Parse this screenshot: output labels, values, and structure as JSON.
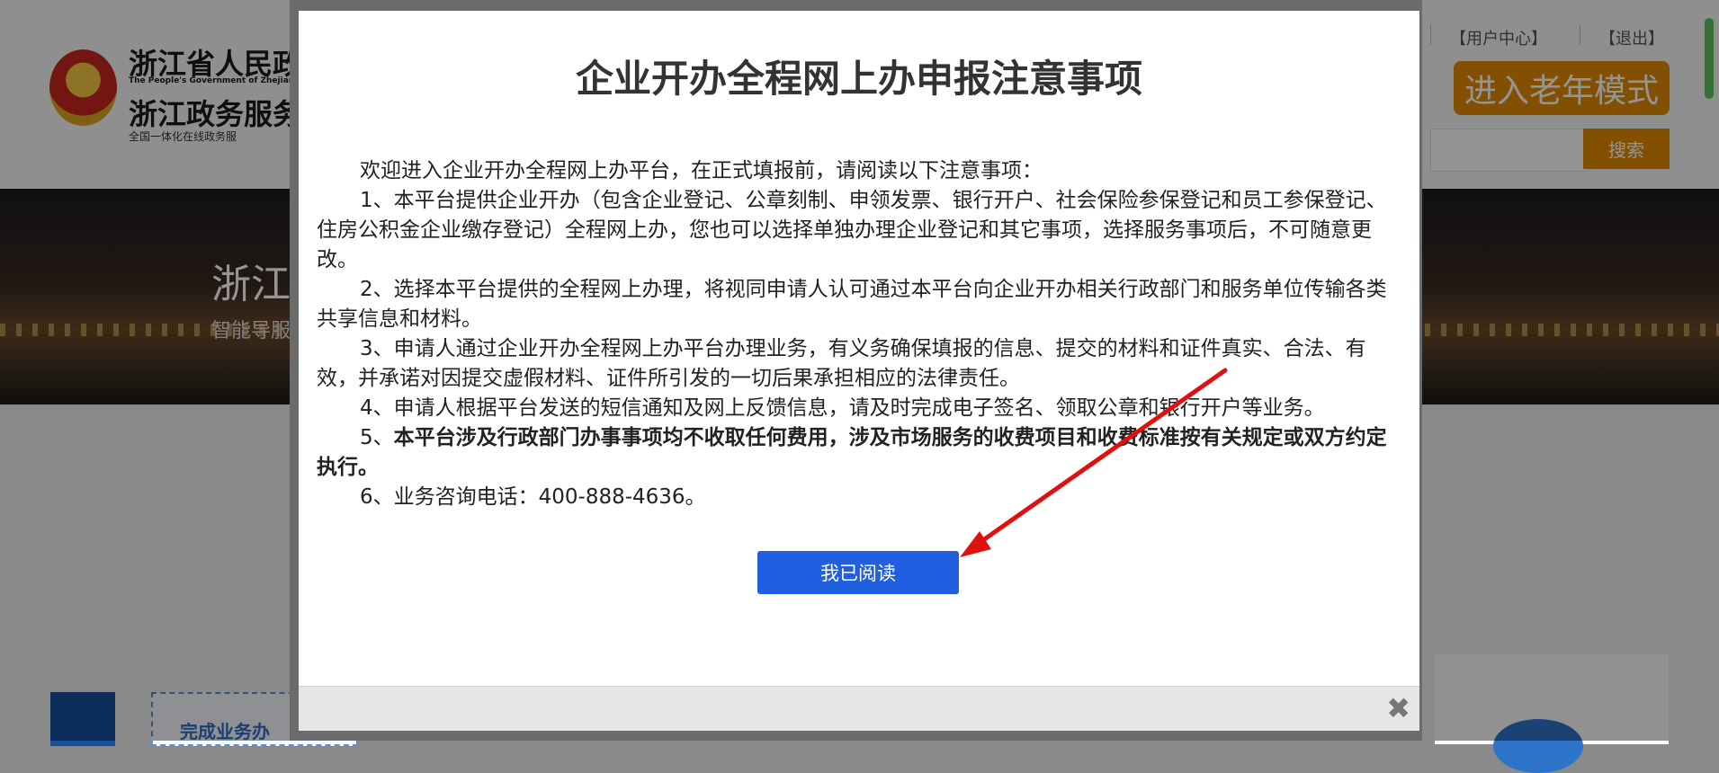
{
  "header": {
    "logo_cn_line1": "浙江省人民政",
    "logo_en": "The People's Government of Zhejiang",
    "logo_cn_line2": "浙江政务服务",
    "logo_sub": "全国一体化在线政务服",
    "user_center": "【用户中心】",
    "logout": "【退出】",
    "elder_mode": "进入老年模式",
    "search_placeholder": "",
    "search_button": "搜索"
  },
  "banner": {
    "title": "浙江",
    "subtitle": "智能导服"
  },
  "lower": {
    "task_card_label": "完成业务办"
  },
  "modal": {
    "title": "企业开办全程网上办申报注意事项",
    "paragraphs": [
      "欢迎进入企业开办全程网上办平台，在正式填报前，请阅读以下注意事项：",
      "1、本平台提供企业开办（包含企业登记、公章刻制、申领发票、银行开户、社会保险参保登记和员工参保登记、住房公积金企业缴存登记）全程网上办，您也可以选择单独办理企业登记和其它事项，选择服务事项后，不可随意更改。",
      "2、选择本平台提供的全程网上办理，将视同申请人认可通过本平台向企业开办相关行政部门和服务单位传输各类共享信息和材料。",
      "3、申请人通过企业开办全程网上办平台办理业务，有义务确保填报的信息、提交的材料和证件真实、合法、有效，并承诺对因提交虚假材料、证件所引发的一切后果承担相应的法律责任。",
      "4、申请人根据平台发送的短信通知及网上反馈信息，请及时完成电子签名、领取公章和银行开户等业务。"
    ],
    "p5_prefix": "5、",
    "p5_bold": "本平台涉及行政部门办事事项均不收取任何费用，涉及市场服务的收费项目和收费标准按有关规定或双方约定执行。",
    "p6": "6、业务咨询电话：400-888-4636。",
    "read_button": "我已阅读",
    "close_symbol": "✖"
  },
  "colors": {
    "primary_button": "#1f5fe0",
    "accent_orange": "#e08b00",
    "annotation_arrow": "#e01010"
  }
}
